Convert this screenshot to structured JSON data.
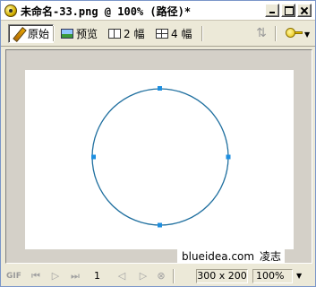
{
  "window": {
    "title": "未命名-33.png @ 100% (路径)*"
  },
  "toolbar": {
    "tabs": [
      {
        "label": "原始",
        "icon": "pencil-icon",
        "active": true
      },
      {
        "label": "预览",
        "icon": "preview-icon",
        "active": false
      },
      {
        "label": "2 幅",
        "icon": "split-2-icon",
        "active": false
      },
      {
        "label": "4 幅",
        "icon": "split-4-icon",
        "active": false
      }
    ],
    "right_icons": [
      "upload-arrows-icon",
      "key-icon"
    ]
  },
  "canvas": {
    "background": "#ffffff",
    "shape": "circle-path",
    "stroke_color": "#1f6f9f",
    "anchor_color": "#1e8fe0",
    "watermark_site": "blueidea.com",
    "watermark_author": "凌志"
  },
  "statusbar": {
    "format_label": "GIF",
    "frame_number": "1",
    "image_size": "300 x 200",
    "zoom": "100%"
  }
}
